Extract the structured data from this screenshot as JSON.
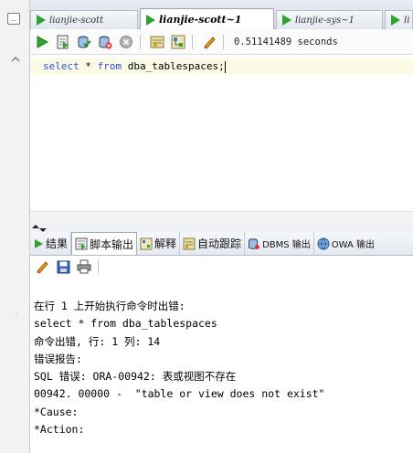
{
  "editor_tabs": [
    {
      "label": "lianjie-scott",
      "active": false
    },
    {
      "label": "lianjie-scott~1",
      "active": true
    },
    {
      "label": "lianjie-sys~1",
      "active": false
    },
    {
      "label": "li",
      "active": false
    }
  ],
  "toolbar": {
    "elapsed_time": "0.51141489 seconds",
    "icons": [
      "run-statement-icon",
      "run-script-icon",
      "commit-icon",
      "rollback-icon",
      "cancel-icon",
      "sql-tuning-icon",
      "explain-plan-icon",
      "clear-icon"
    ]
  },
  "editor": {
    "line": {
      "kw1": "select",
      "mid": " * ",
      "kw2": "from",
      "rest": " dba_tablespaces;"
    }
  },
  "output_tabs": [
    {
      "label": "结果",
      "icon": "results-icon"
    },
    {
      "label": "脚本输出",
      "icon": "script-output-icon"
    },
    {
      "label": "解释",
      "icon": "explain-icon"
    },
    {
      "label": "自动跟踪",
      "icon": "autotrace-icon"
    },
    {
      "label": "DBMS 输出",
      "icon": "dbms-output-icon"
    },
    {
      "label": "OWA 输出",
      "icon": "owa-output-icon"
    }
  ],
  "output_toolbar_icons": [
    "clear-icon",
    "save-icon",
    "print-icon"
  ],
  "output_lines": [
    "在行 1 上开始执行命令时出错:",
    "select * from dba_tablespaces",
    "命令出错, 行: 1 列: 14",
    "错误报告:",
    "SQL 错误: ORA-00942: 表或视图不存在",
    "00942. 00000 -  \"table or view does not exist\"",
    "*Cause:",
    "*Action:"
  ],
  "colors": {
    "keyword": "#2c4fd1",
    "current_line": "#fbfbe6",
    "run_green": "#2ea42e"
  }
}
